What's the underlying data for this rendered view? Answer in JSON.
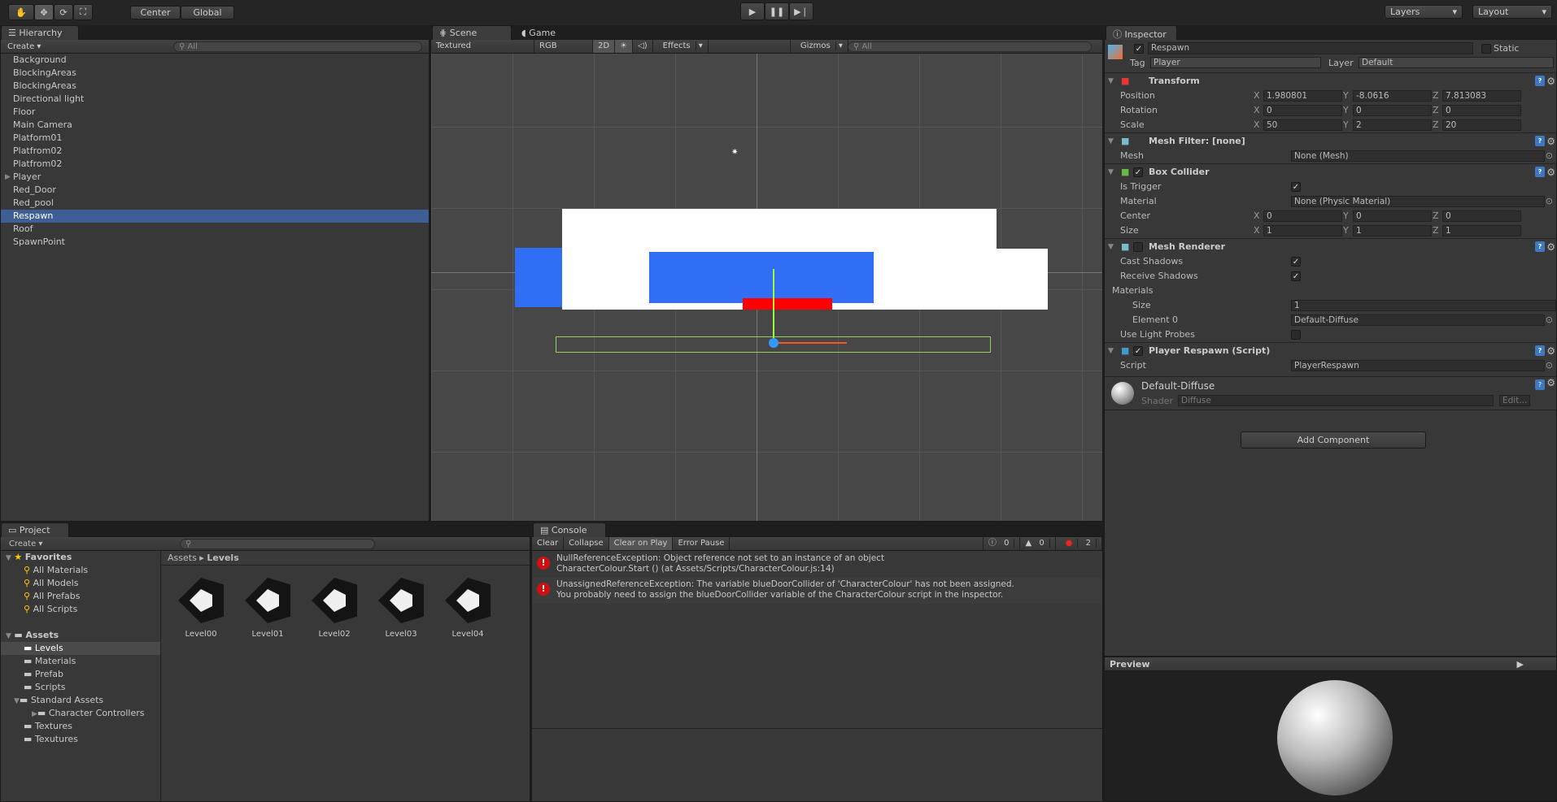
{
  "toolbar": {
    "tools": [
      "hand-icon",
      "move-icon",
      "rotate-icon",
      "scale-icon"
    ],
    "pivot": "Center",
    "space": "Global",
    "layers": "Layers",
    "layout": "Layout"
  },
  "hierarchy": {
    "tab": "Hierarchy",
    "create": "Create",
    "search_placeholder": "All",
    "items": [
      "Background",
      "BlockingAreas",
      "BlockingAreas",
      "Directional light",
      "Floor",
      "Main Camera",
      "Platform01",
      "Platfrom02",
      "Platfrom02",
      "Player",
      "Red_Door",
      "Red_pool",
      "Respawn",
      "Roof",
      "SpawnPoint"
    ],
    "selected": "Respawn"
  },
  "scene": {
    "tab_scene": "Scene",
    "tab_game": "Game",
    "render_mode": "Textured",
    "color_mode": "RGB",
    "mode_2d": "2D",
    "effects": "Effects",
    "gizmos": "Gizmos",
    "search_placeholder": "All"
  },
  "inspector": {
    "tab": "Inspector",
    "name": "Respawn",
    "static": "Static",
    "tag_label": "Tag",
    "tag": "Player",
    "layer_label": "Layer",
    "layer": "Default",
    "transform": {
      "title": "Transform",
      "position_label": "Position",
      "position": [
        "1.980801",
        "-8.0616",
        "7.813083"
      ],
      "rotation_label": "Rotation",
      "rotation": [
        "0",
        "0",
        "0"
      ],
      "scale_label": "Scale",
      "scale": [
        "50",
        "2",
        "20"
      ]
    },
    "mesh_filter": {
      "title": "Mesh Filter: [none]",
      "mesh_label": "Mesh",
      "mesh": "None (Mesh)"
    },
    "box_collider": {
      "title": "Box Collider",
      "is_trigger_label": "Is Trigger",
      "material_label": "Material",
      "material": "None (Physic Material)",
      "center_label": "Center",
      "center": [
        "0",
        "0",
        "0"
      ],
      "size_label": "Size",
      "size": [
        "1",
        "1",
        "1"
      ]
    },
    "mesh_renderer": {
      "title": "Mesh Renderer",
      "cast_label": "Cast Shadows",
      "receive_label": "Receive Shadows",
      "materials_label": "Materials",
      "size_label": "Size",
      "size": "1",
      "element_label": "Element 0",
      "element": "Default-Diffuse",
      "probes_label": "Use Light Probes"
    },
    "script": {
      "title": "Player Respawn (Script)",
      "script_label": "Script",
      "script": "PlayerRespawn"
    },
    "material": {
      "name": "Default-Diffuse",
      "shader_label": "Shader",
      "shader": "Diffuse",
      "edit": "Edit..."
    },
    "add_component": "Add Component",
    "axes": [
      "X",
      "Y",
      "Z"
    ]
  },
  "preview": {
    "title": "Preview"
  },
  "project": {
    "tab": "Project",
    "create": "Create",
    "favorites_label": "Favorites",
    "favorites": [
      "All Materials",
      "All Models",
      "All Prefabs",
      "All Scripts"
    ],
    "assets_label": "Assets",
    "folders": [
      "Levels",
      "Materials",
      "Prefab",
      "Scripts",
      "Standard Assets",
      "Character Controllers",
      "Textures",
      "Texutures"
    ],
    "breadcrumb": [
      "Assets",
      "Levels"
    ],
    "files": [
      "Level00",
      "Level01",
      "Level02",
      "Level03",
      "Level04"
    ]
  },
  "console": {
    "tab": "Console",
    "buttons": [
      "Clear",
      "Collapse",
      "Clear on Play",
      "Error Pause"
    ],
    "counts": {
      "info": "0",
      "warn": "0",
      "error": "2"
    },
    "messages": [
      {
        "line1": "NullReferenceException: Object reference not set to an instance of an object",
        "line2": "CharacterColour.Start () (at Assets/Scripts/CharacterColour.js:14)"
      },
      {
        "line1": "UnassignedReferenceException: The variable blueDoorCollider of 'CharacterColour' has not been assigned.",
        "line2": "You probably need to assign the blueDoorCollider variable of the CharacterColour script in the inspector."
      }
    ]
  },
  "colors": {
    "selection": "#3e5f96",
    "scene_blue": "#2f6ef5",
    "scene_red": "#ff0000",
    "error": "#d01010"
  }
}
